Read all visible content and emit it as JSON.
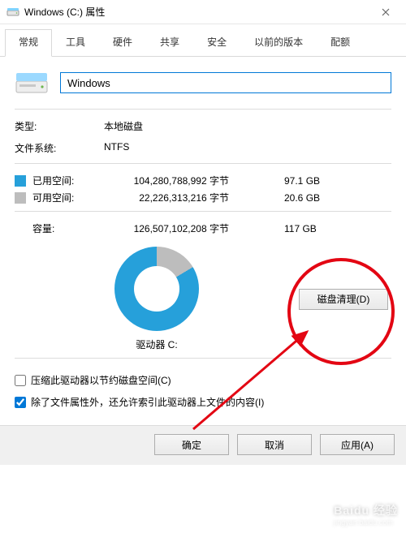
{
  "titlebar": {
    "title": "Windows (C:) 属性"
  },
  "tabs": [
    "常规",
    "工具",
    "硬件",
    "共享",
    "安全",
    "以前的版本",
    "配额"
  ],
  "active_tab_index": 0,
  "drive_name": "Windows",
  "type_label": "类型:",
  "type_value": "本地磁盘",
  "filesystem_label": "文件系统:",
  "filesystem_value": "NTFS",
  "used": {
    "label": "已用空间:",
    "bytes": "104,280,788,992 字节",
    "size": "97.1 GB"
  },
  "free": {
    "label": "可用空间:",
    "bytes": "22,226,313,216 字节",
    "size": "20.6 GB"
  },
  "capacity": {
    "label": "容量:",
    "bytes": "126,507,102,208 字节",
    "size": "117 GB"
  },
  "drive_caption": "驱动器 C:",
  "disk_cleanup_button": "磁盘清理(D)",
  "compress_checkbox": "压缩此驱动器以节约磁盘空间(C)",
  "index_checkbox": "除了文件属性外，还允许索引此驱动器上文件的内容(I)",
  "index_checked": true,
  "compress_checked": false,
  "buttons": {
    "ok": "确定",
    "cancel": "取消",
    "apply": "应用(A)"
  },
  "chart_data": {
    "type": "pie",
    "title": "驱动器 C:",
    "series": [
      {
        "name": "已用空间",
        "value": 104280788992,
        "display": "97.1 GB",
        "color": "#26a0da"
      },
      {
        "name": "可用空间",
        "value": 22226313216,
        "display": "20.6 GB",
        "color": "#bdbdbd"
      }
    ]
  },
  "watermark": {
    "main": "Baidu 经验",
    "sub": "jingyan.baidu.com"
  }
}
